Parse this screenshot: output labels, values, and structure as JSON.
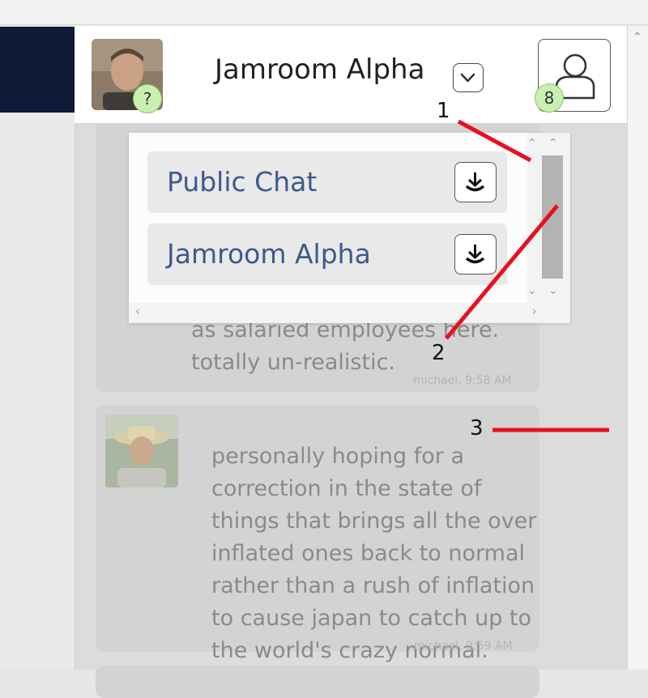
{
  "header": {
    "room_title": "Jamroom Alpha",
    "user_badge": "?",
    "notification_badge": "8"
  },
  "menu": {
    "items": [
      {
        "label": "Public Chat"
      },
      {
        "label": "Jamroom Alpha"
      }
    ]
  },
  "messages": [
    {
      "lines": [
        "as salaried employees here.",
        "totally un-realistic."
      ],
      "meta": "michael, 9:58 AM"
    },
    {
      "lines": [
        "personally hoping for a",
        "correction in the state of",
        "things that brings all the over",
        "inflated ones back to normal",
        "rather than a rush of inflation",
        "to cause japan to catch up to",
        "the world's crazy normal."
      ],
      "meta": "michael, 9:59 AM"
    }
  ],
  "annotations": {
    "one": "1",
    "two": "2",
    "three": "3"
  },
  "colors": {
    "badge": "#c9f0b0",
    "link": "#3d5a8a",
    "annotation": "#e8101e",
    "sidebar_dark": "#0e1a38"
  }
}
